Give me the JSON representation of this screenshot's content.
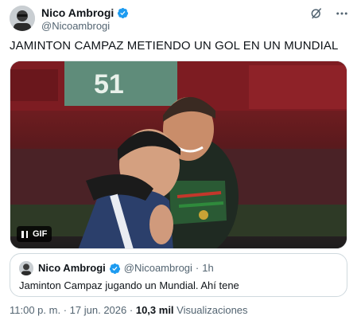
{
  "author": {
    "display_name": "Nico Ambrogi",
    "handle": "@Nicoambrogi"
  },
  "tweet": {
    "text": "JAMINTON CAMPAZ METIENDO UN GOL EN UN MUNDIAL"
  },
  "media": {
    "type_label": "GIF",
    "jersey_number": "51"
  },
  "quote": {
    "display_name": "Nico Ambrogi",
    "handle": "@Nicoambrogi",
    "separator": "·",
    "time": "1h",
    "text": "Jaminton Campaz jugando un Mundial. Ahí tene"
  },
  "footer": {
    "time": "11:00 p. m.",
    "sep1": "·",
    "date": "17 jun. 2026",
    "sep2": "·",
    "views_count": "10,3 mil",
    "views_label": "Visualizaciones"
  },
  "colors": {
    "verified_blue": "#1d9bf0",
    "secondary_text": "#536471"
  }
}
